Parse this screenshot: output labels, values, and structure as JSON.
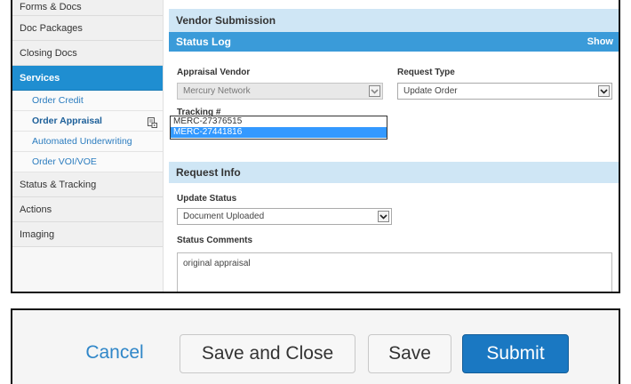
{
  "sidebar": {
    "items": [
      {
        "label": "Forms & Docs"
      },
      {
        "label": "Doc Packages"
      },
      {
        "label": "Closing Docs"
      },
      {
        "label": "Services"
      }
    ],
    "sub_items": [
      {
        "label": "Order Credit"
      },
      {
        "label": "Order Appraisal"
      },
      {
        "label": "Automated Underwriting"
      },
      {
        "label": "Order VOI/VOE"
      }
    ],
    "lower_items": [
      {
        "label": "Status & Tracking"
      },
      {
        "label": "Actions"
      },
      {
        "label": "Imaging"
      }
    ],
    "active_item": "Services",
    "accent_color": "#1f8ed1"
  },
  "main": {
    "vendor_submission": {
      "title": "Vendor Submission"
    },
    "status_log": {
      "title": "Status Log",
      "show_label": "Show"
    },
    "appraisal_vendor": {
      "label": "Appraisal Vendor",
      "value": "Mercury Network"
    },
    "request_type": {
      "label": "Request Type",
      "value": "Update Order"
    },
    "tracking": {
      "label": "Tracking #",
      "options": [
        "MERC-27376515",
        "MERC-27441816"
      ],
      "selected": "MERC-27441816"
    },
    "request_info": {
      "title": "Request Info"
    },
    "update_status": {
      "label": "Update Status",
      "value": "Document Uploaded"
    },
    "status_comments": {
      "label": "Status Comments",
      "value": "original appraisal"
    }
  },
  "footer": {
    "cancel_label": "Cancel",
    "save_close_label": "Save and Close",
    "save_label": "Save",
    "submit_label": "Submit",
    "primary_color": "#1a78c2"
  },
  "icons": {
    "order_appraisal": "document-lock-icon",
    "dropdown": "chevron-down-icon"
  }
}
